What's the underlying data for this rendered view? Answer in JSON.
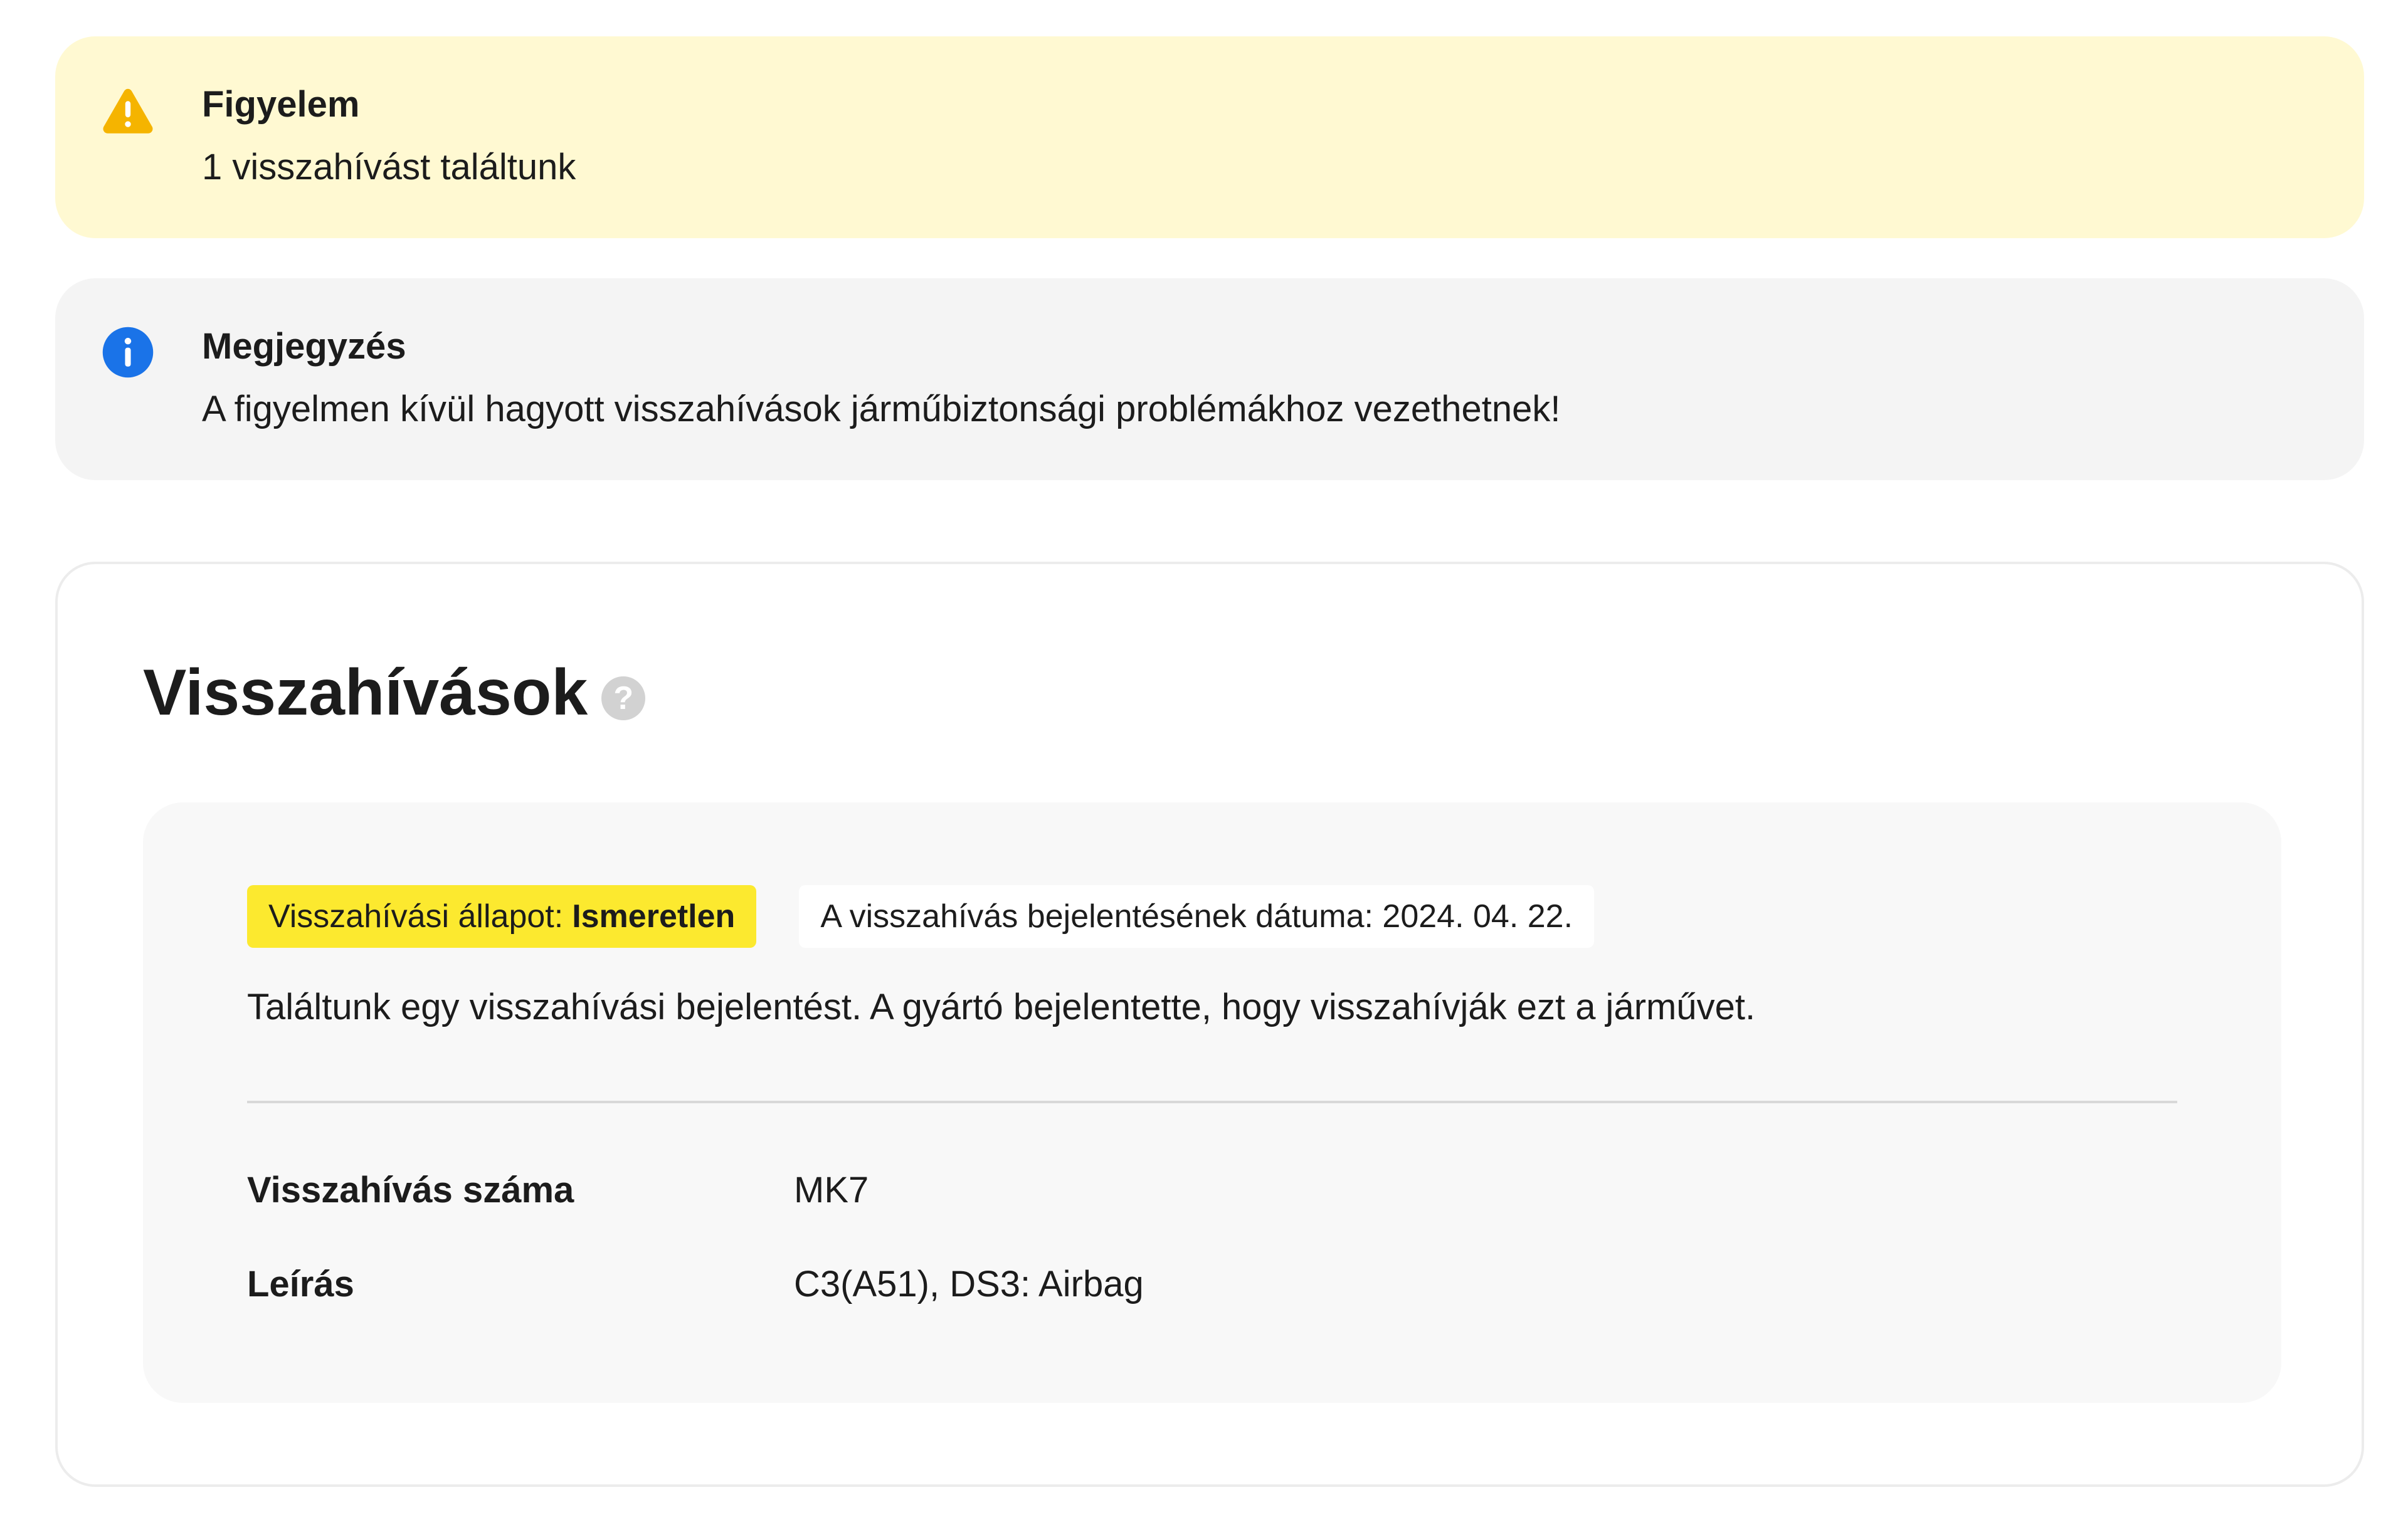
{
  "warning": {
    "title": "Figyelem",
    "message": "1 visszahívást találtunk",
    "color": "#f5b400"
  },
  "note": {
    "title": "Megjegyzés",
    "message": "A figyelmen kívül hagyott visszahívások járműbiztonsági problémákhoz vezethetnek!",
    "color": "#1a73e8"
  },
  "recalls": {
    "title": "Visszahívások",
    "help_icon": "question-mark-icon",
    "item": {
      "status_label": "Visszahívási állapot:",
      "status_value": "Ismeretlen",
      "date_text": "A visszahívás bejelentésének dátuma: 2024. 04. 22.",
      "description": "Találtunk egy visszahívási bejelentést. A gyártó bejelentette, hogy visszahívják ezt a járművet.",
      "details": [
        {
          "label": "Visszahívás száma",
          "value": "MK7"
        },
        {
          "label": "Leírás",
          "value": "C3(A51), DS3: Airbag"
        }
      ]
    }
  }
}
